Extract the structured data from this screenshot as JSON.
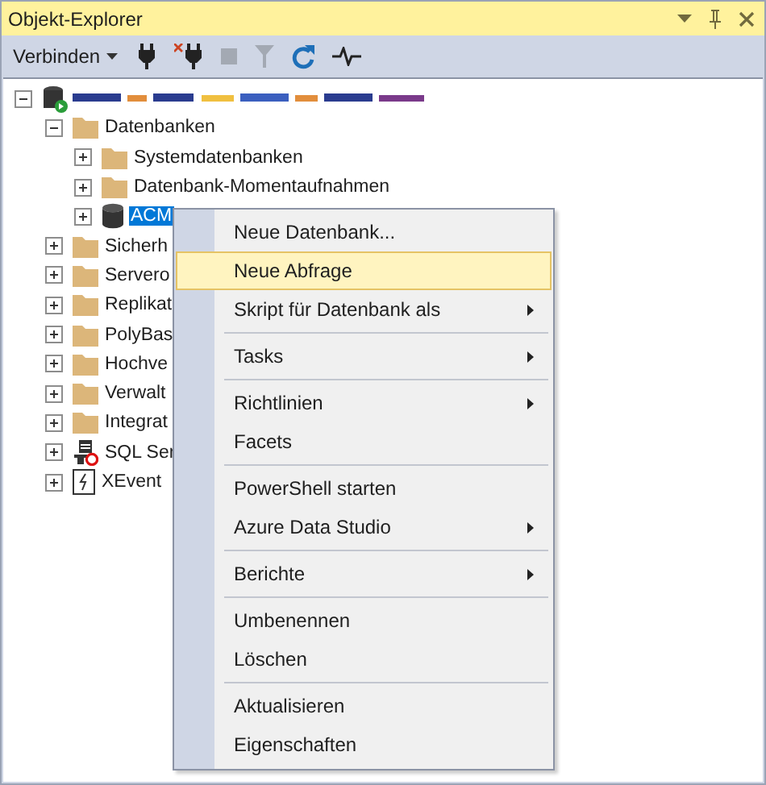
{
  "panel": {
    "title": "Objekt-Explorer"
  },
  "toolbar": {
    "connect_label": "Verbinden"
  },
  "tree": {
    "expanded": true,
    "children": [
      {
        "label": "Datenbanken",
        "kind": "folder",
        "expanded": true,
        "children": [
          {
            "label": "Systemdatenbanken",
            "kind": "folder",
            "expanded": false,
            "selected": false
          },
          {
            "label": "Datenbank-Momentaufnahmen",
            "kind": "folder",
            "expanded": false,
            "selected": false
          },
          {
            "label": "ACM",
            "kind": "database",
            "expanded": false,
            "selected": true
          }
        ]
      },
      {
        "label": "Sicherh",
        "kind": "folder",
        "expanded": false
      },
      {
        "label": "Servero",
        "kind": "folder",
        "expanded": false
      },
      {
        "label": "Replikat",
        "kind": "folder",
        "expanded": false
      },
      {
        "label": "PolyBas",
        "kind": "folder",
        "expanded": false
      },
      {
        "label": "Hochve",
        "kind": "folder",
        "expanded": false
      },
      {
        "label": "Verwalt",
        "kind": "folder",
        "expanded": false
      },
      {
        "label": "Integrat",
        "kind": "folder",
        "expanded": false
      },
      {
        "label": "SQL Ser",
        "kind": "agent",
        "expanded": false
      },
      {
        "label": "XEvent",
        "kind": "xevent",
        "expanded": false
      }
    ]
  },
  "context_menu": [
    {
      "kind": "item",
      "label": "Neue Datenbank...",
      "submenu": false,
      "selected": false
    },
    {
      "kind": "item",
      "label": "Neue Abfrage",
      "submenu": false,
      "selected": true
    },
    {
      "kind": "item",
      "label": "Skript für Datenbank als",
      "submenu": true,
      "selected": false
    },
    {
      "kind": "separator"
    },
    {
      "kind": "item",
      "label": "Tasks",
      "submenu": true,
      "selected": false
    },
    {
      "kind": "separator"
    },
    {
      "kind": "item",
      "label": "Richtlinien",
      "submenu": true,
      "selected": false
    },
    {
      "kind": "item",
      "label": "Facets",
      "submenu": false,
      "selected": false
    },
    {
      "kind": "separator"
    },
    {
      "kind": "item",
      "label": "PowerShell starten",
      "submenu": false,
      "selected": false
    },
    {
      "kind": "item",
      "label": "Azure Data Studio",
      "submenu": true,
      "selected": false
    },
    {
      "kind": "separator"
    },
    {
      "kind": "item",
      "label": "Berichte",
      "submenu": true,
      "selected": false
    },
    {
      "kind": "separator"
    },
    {
      "kind": "item",
      "label": "Umbenennen",
      "submenu": false,
      "selected": false
    },
    {
      "kind": "item",
      "label": "Löschen",
      "submenu": false,
      "selected": false
    },
    {
      "kind": "separator"
    },
    {
      "kind": "item",
      "label": "Aktualisieren",
      "submenu": false,
      "selected": false
    },
    {
      "kind": "item",
      "label": "Eigenschaften",
      "submenu": false,
      "selected": false
    }
  ]
}
